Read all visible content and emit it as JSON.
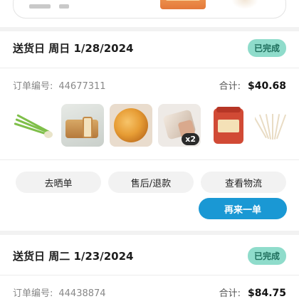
{
  "orders": [
    {
      "date": "送货日 周日 1/28/2024",
      "status": "已完成",
      "order_label": "订单编号:",
      "order_number": "44677311",
      "total_label": "合计:",
      "total": "$40.68",
      "items": [
        {
          "name": "scallion"
        },
        {
          "name": "bread-loaf"
        },
        {
          "name": "pastry"
        },
        {
          "name": "bread",
          "qty": "x2"
        },
        {
          "name": "kimchi-jar"
        },
        {
          "name": "noodles"
        }
      ],
      "actions": [
        "去晒单",
        "售后/退款",
        "查看物流"
      ],
      "reorder": "再来一单"
    },
    {
      "date": "送货日 周二 1/23/2024",
      "status": "已完成",
      "order_label": "订单编号:",
      "order_number": "44438874",
      "total_label": "合计:",
      "total": "$84.75"
    }
  ],
  "colors": {
    "accent": "#1a98d4",
    "status_bg": "#8fdccb",
    "status_text": "#1e6e5c"
  }
}
